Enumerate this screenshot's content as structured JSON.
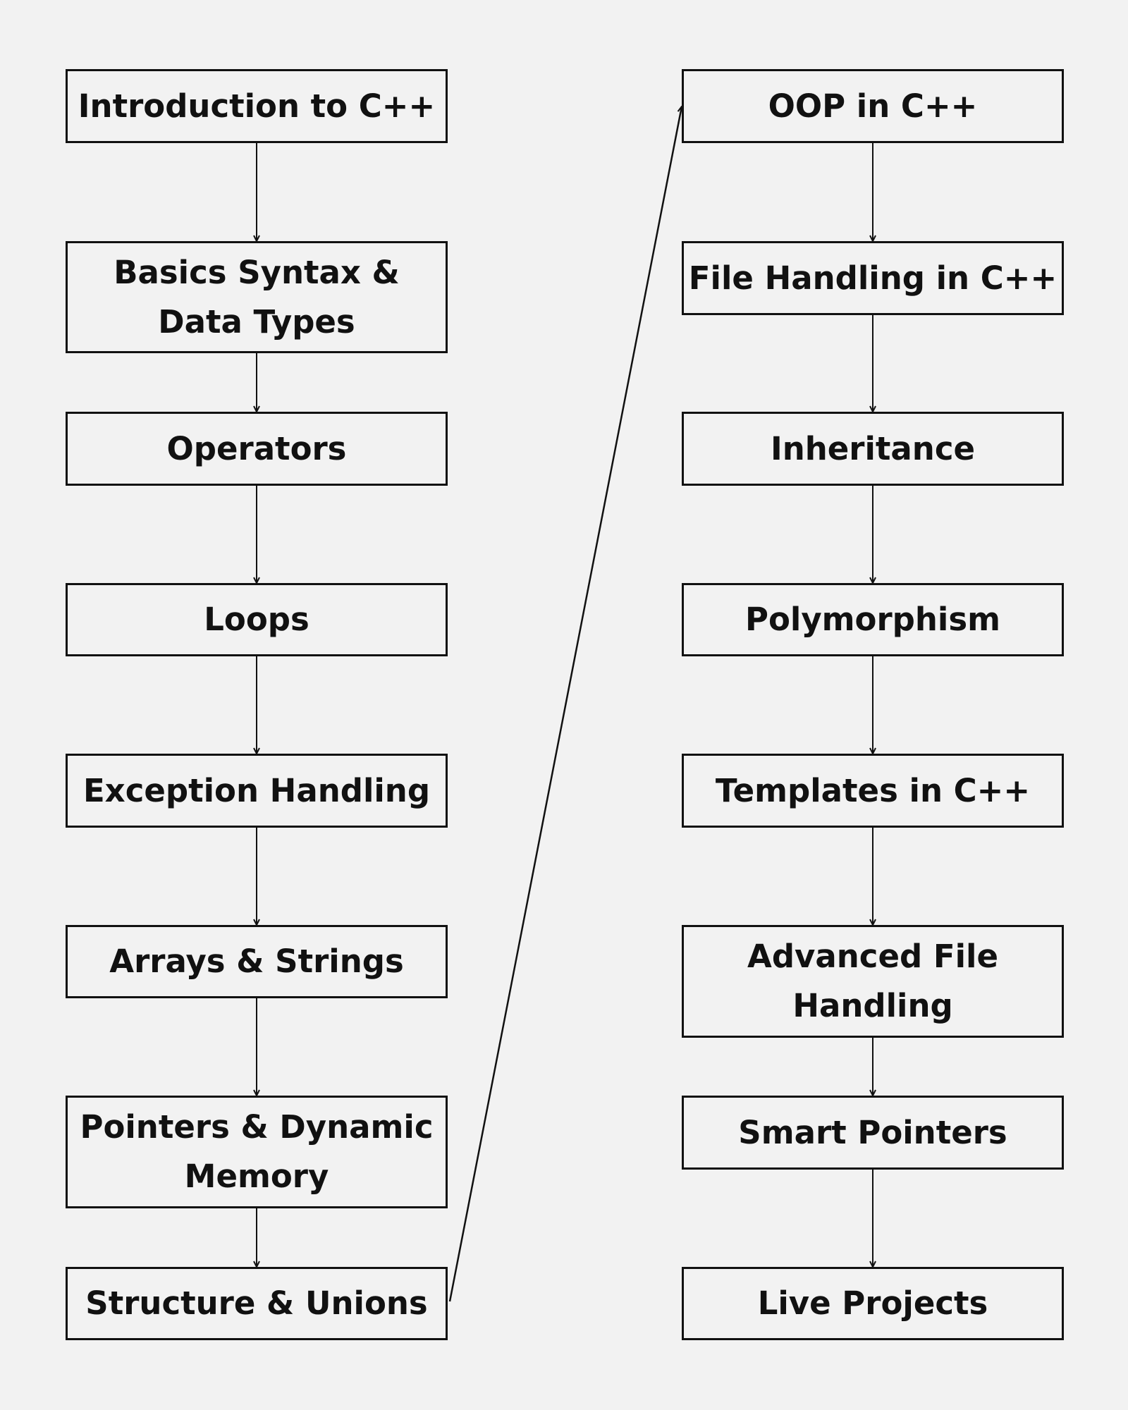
{
  "left_column": [
    "Introduction to C++",
    "Basics Syntax & Data Types",
    "Operators",
    "Loops",
    "Exception Handling",
    "Arrays & Strings",
    "Pointers & Dynamic Memory",
    "Structure & Unions"
  ],
  "right_column": [
    "OOP in C++",
    "File Handling in C++",
    "Inheritance",
    "Polymorphism",
    "Templates in C++",
    "Advanced File Handling",
    "Smart Pointers",
    "Live Projects"
  ],
  "colors": {
    "background": "#f2f2f2",
    "stroke": "#111111"
  }
}
